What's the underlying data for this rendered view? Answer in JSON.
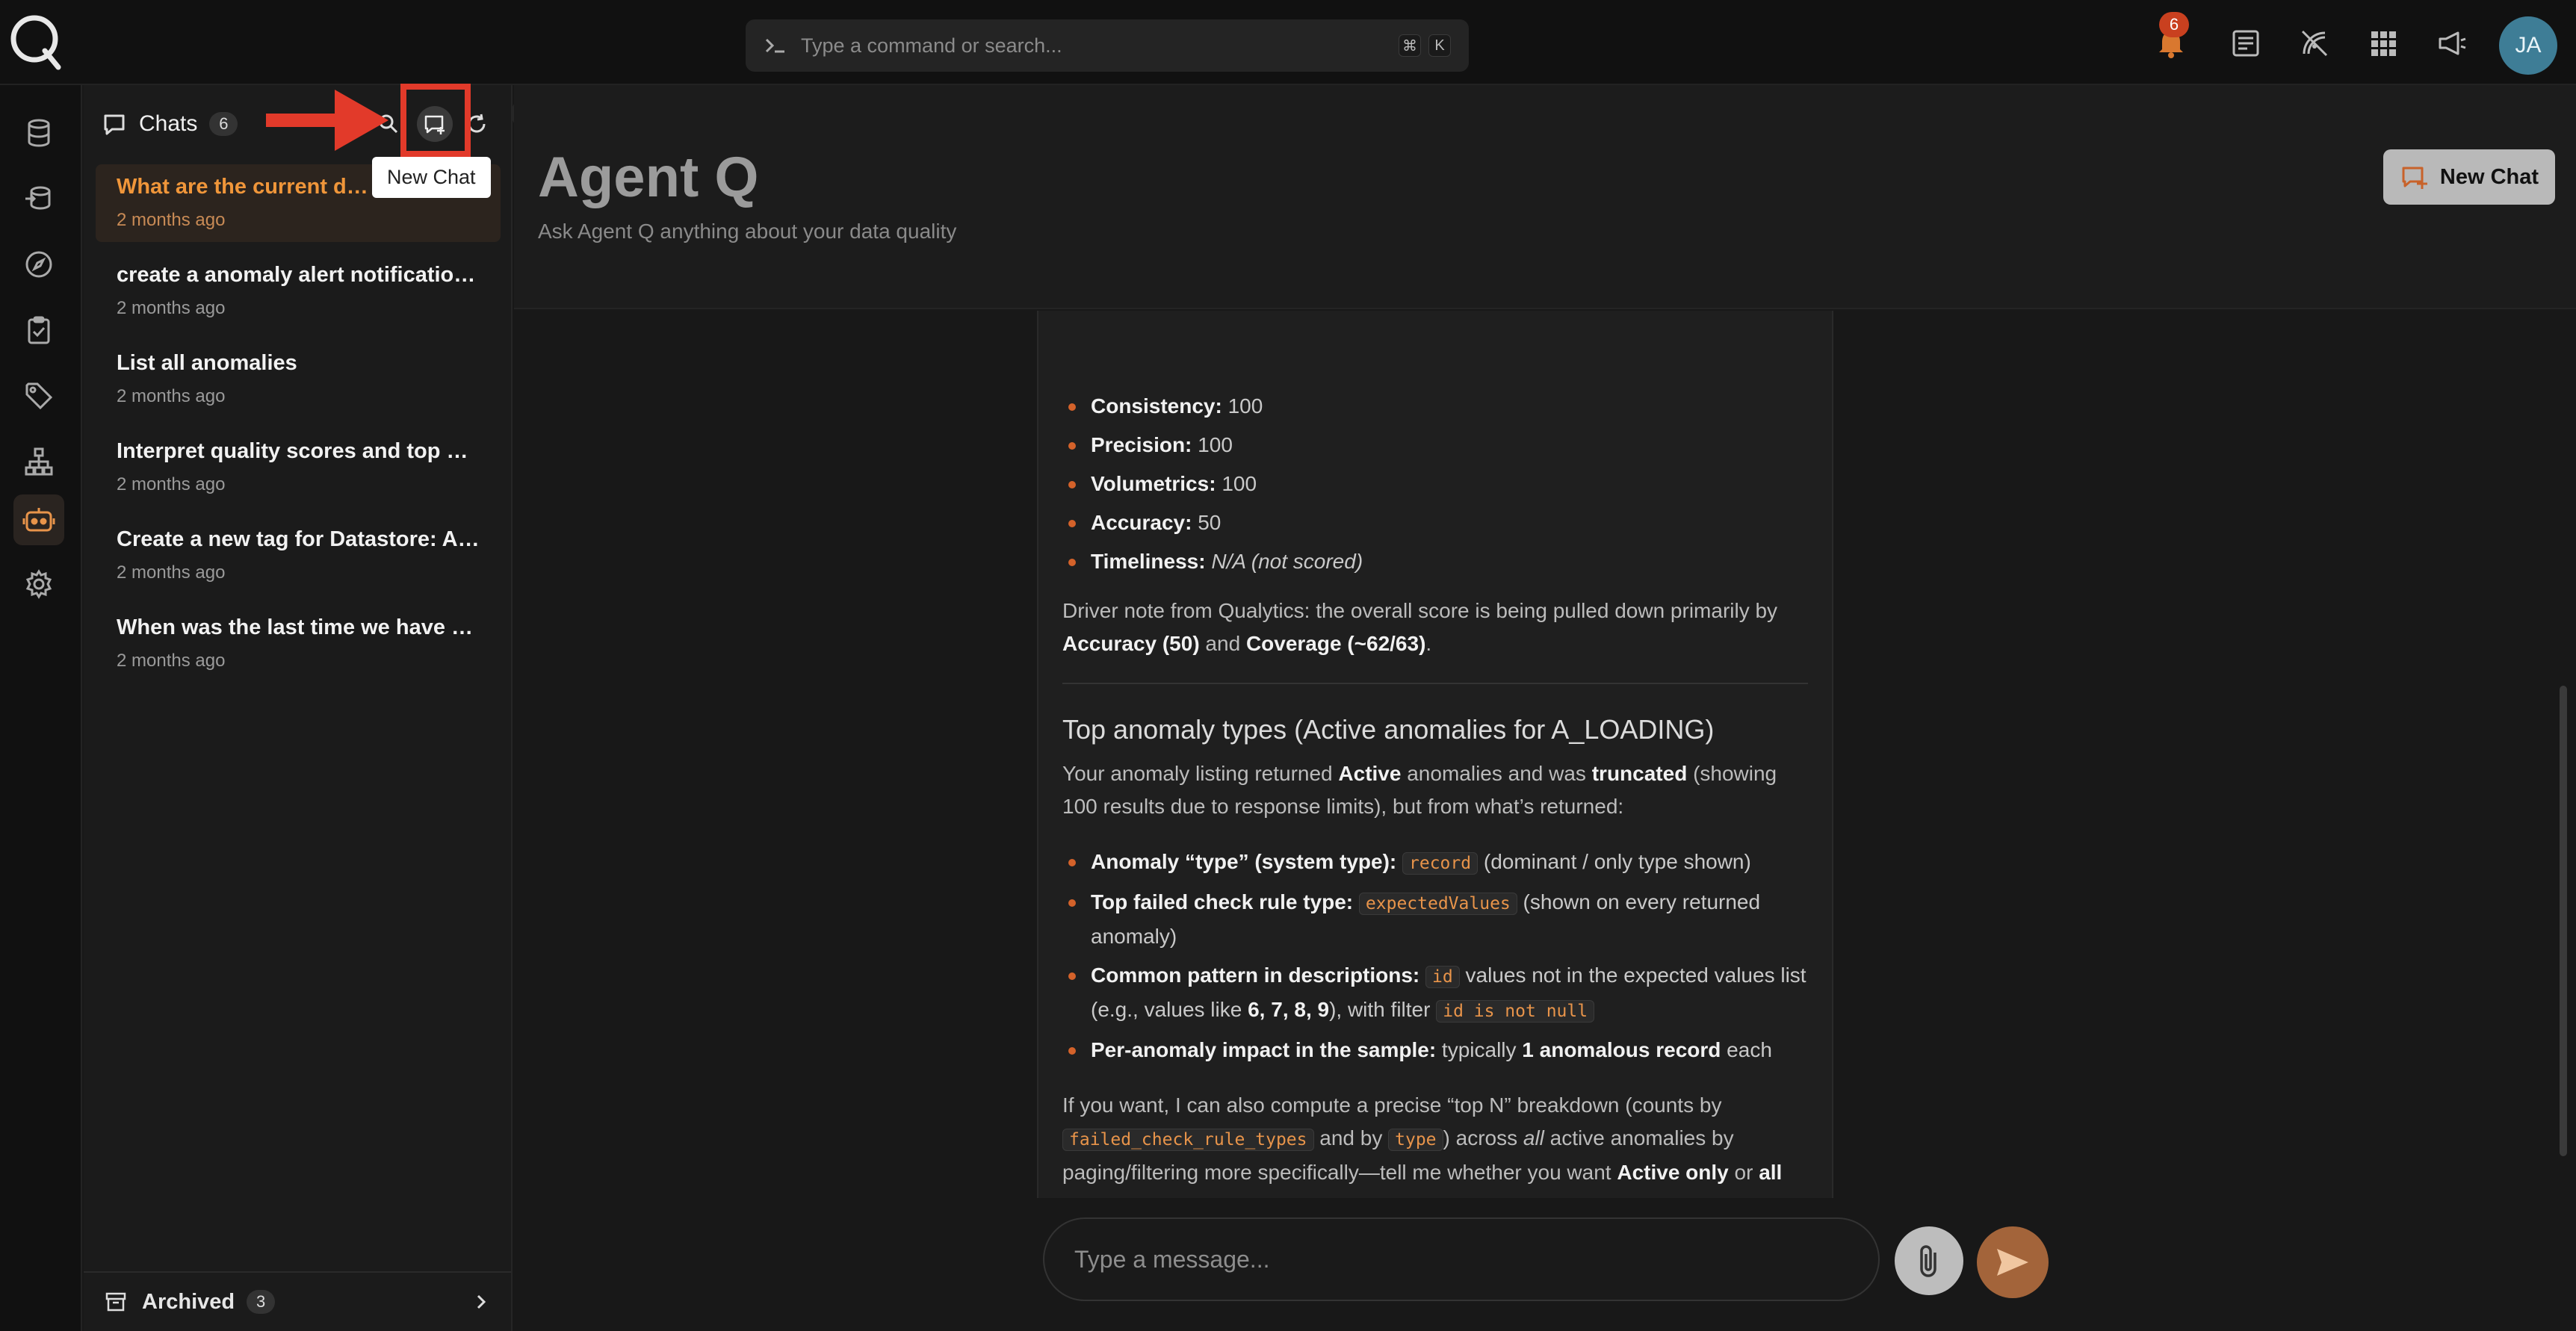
{
  "topbar": {
    "search_placeholder": "Type a command or search...",
    "shortcut_key1": "⌘",
    "shortcut_key2": "K",
    "notification_count": "6",
    "avatar_initials": "JA"
  },
  "sidebar": {
    "title": "Chats",
    "count": "6",
    "tooltip": "New Chat",
    "chats": [
      {
        "title": "What are the current data",
        "date": "2 months ago",
        "active": true
      },
      {
        "title": "create a anomaly alert notification ...",
        "date": "2 months ago"
      },
      {
        "title": "List all anomalies",
        "date": "2 months ago"
      },
      {
        "title": "Interpret quality scores and top an...",
        "date": "2 months ago"
      },
      {
        "title": "Create a new tag for Datastore: An...",
        "date": "2 months ago"
      },
      {
        "title": "When was the last time we have an ...",
        "date": "2 months ago"
      }
    ],
    "archived_label": "Archived",
    "archived_count": "3"
  },
  "header": {
    "title": "Agent Q",
    "subtitle": "Ask Agent Q anything about your data quality",
    "new_chat_label": "New Chat"
  },
  "message": {
    "scores": [
      {
        "label": "Consistency:",
        "value": "100"
      },
      {
        "label": "Precision:",
        "value": "100"
      },
      {
        "label": "Volumetrics:",
        "value": "100"
      },
      {
        "label": "Accuracy:",
        "value": "50"
      },
      {
        "label": "Timeliness:",
        "value": "N/A (not scored)"
      }
    ],
    "driver_note_1": "Driver note from Qualytics: the overall score is being pulled down primarily by",
    "driver_accuracy": "Accuracy (50)",
    "driver_and": " and ",
    "driver_coverage": "Coverage (~62/63)",
    "driver_end": ".",
    "section_title": "Top anomaly types (Active anomalies for A_LOADING)",
    "intro_1": "Your anomaly listing returned ",
    "intro_active": "Active",
    "intro_2": " anomalies and was ",
    "intro_truncated": "truncated",
    "intro_3": " (showing 100 results due to response limits), but from what’s returned:",
    "b1_label": "Anomaly “type” (system type):",
    "b1_code": "record",
    "b1_rest": " (dominant / only type shown)",
    "b2_label": "Top failed check rule type:",
    "b2_code": "expectedValues",
    "b2_rest": " (shown on every returned anomaly)",
    "b3_label": "Common pattern in descriptions:",
    "b3_code": "id",
    "b3_rest1": " values not in the expected values list (e.g., values like ",
    "b3_values": "6, 7, 8, 9",
    "b3_rest2": "), with filter ",
    "b3_code2": "id is not null",
    "b4_label": "Per-anomaly impact in the sample:",
    "b4_rest1": " typically ",
    "b4_bold": "1 anomalous record",
    "b4_rest2": " each",
    "outro_1": "If you want, I can also compute a precise “top N” breakdown (counts by ",
    "outro_code1": "failed_check_rule_types",
    "outro_2": " and by ",
    "outro_code2": "type",
    "outro_3": ") across ",
    "outro_all_italic": "all",
    "outro_4": " active anomalies by paging/filtering more specifically—tell me whether you want ",
    "outro_active_only": "Active only",
    "outro_or": " or ",
    "outro_all_statuses": "all statuses",
    "outro_end": "."
  },
  "composer": {
    "placeholder": "Type a message..."
  },
  "colors": {
    "accent": "#f0963a",
    "bullet": "#d4622a",
    "highlight_box": "#e23a2a"
  }
}
